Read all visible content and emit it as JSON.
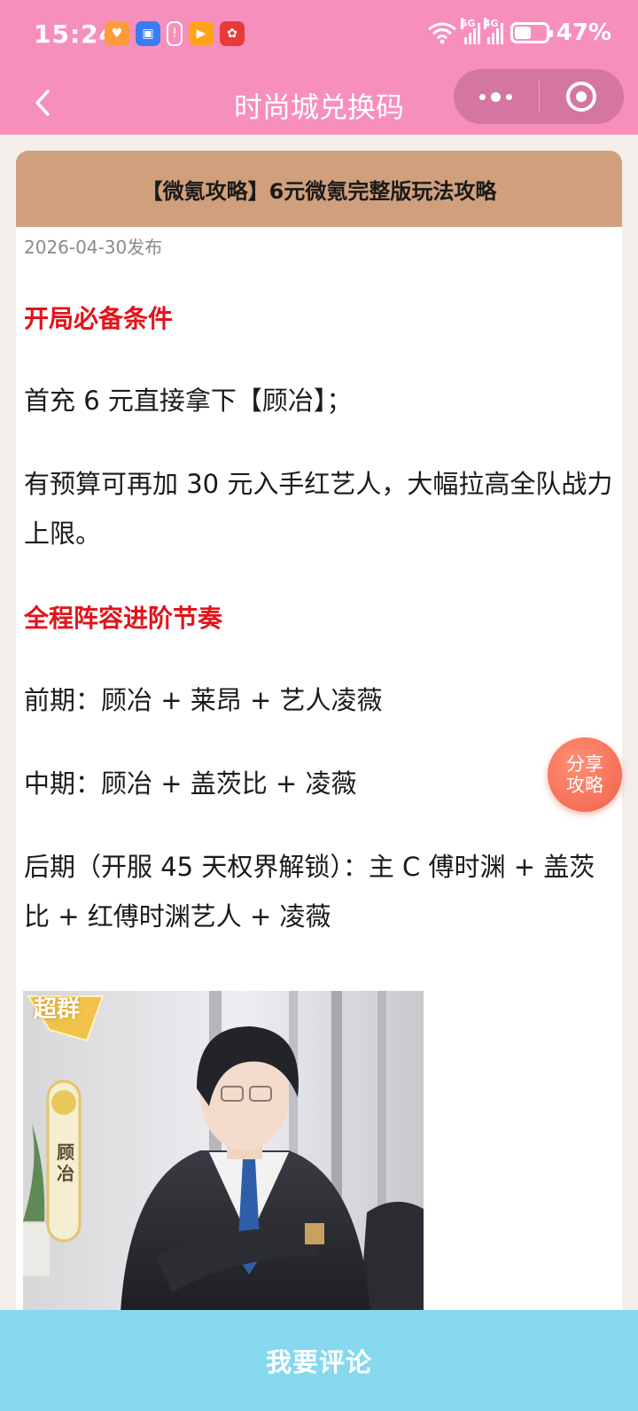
{
  "status_bar": {
    "time": "15:24",
    "battery_text": "47%",
    "battery_level": 0.47,
    "network_5g": "5G",
    "network_4g": "4G",
    "app_icons": [
      "heart-app-icon",
      "market-app-icon",
      "alert-app-icon",
      "video-app-icon",
      "game-app-icon"
    ]
  },
  "nav": {
    "title": "时尚城兑换码"
  },
  "article": {
    "header_title": "【微氪攻略】6元微氪完整版玩法攻略",
    "publish_date": "2026-04-30发布",
    "section1_title": "开局必备条件",
    "para1": "首充 6 元直接拿下【顾冶】；",
    "para2": "有预算可再加 30 元入手红艺人，大幅拉高全队战力上限。",
    "section2_title": "全程阵容进阶节奏",
    "para3": "前期：顾冶 + 莱昂 + 艺人凌薇",
    "para4": "中期：顾冶 + 盖茨比 + 凌薇",
    "para5": "后期（开服 45 天权界解锁）：主 C 傅时渊 + 盖茨比 + 红傅时渊艺人 + 凌薇",
    "image": {
      "badge_text": "超群",
      "tag_text": "顾冶"
    }
  },
  "share_button": "分享攻略",
  "comment_button": "我要评论",
  "colors": {
    "brand_pink": "#f78fbd",
    "header_brown": "#d0a07c",
    "section_red": "#e3131b",
    "comment_blue": "#85d8ee",
    "share_orange": "#f2614c"
  }
}
